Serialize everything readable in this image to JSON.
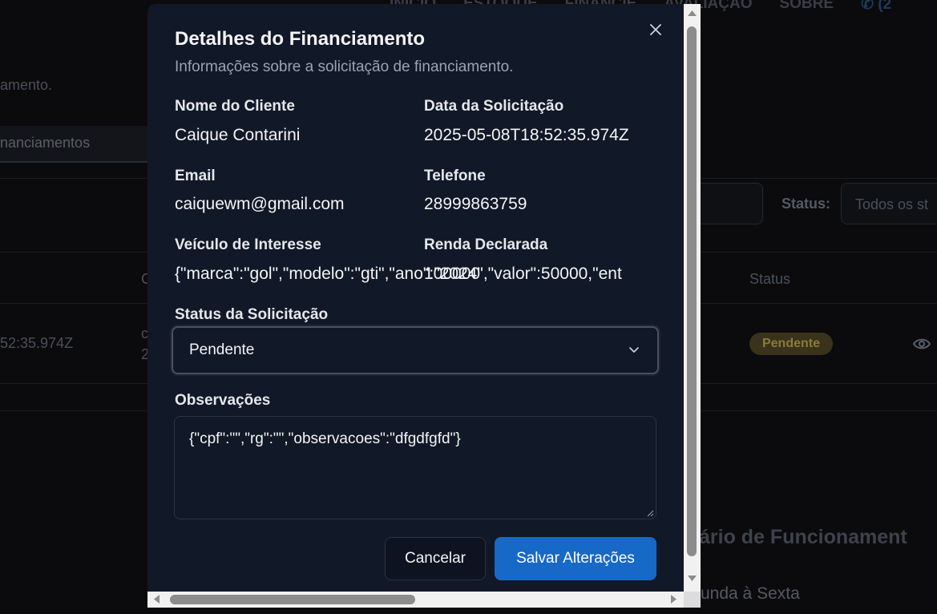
{
  "background": {
    "nav": [
      "INÍCIO",
      "ESTOQUE",
      "FINANCIE",
      "AVALIAÇÃO",
      "SOBRE"
    ],
    "phone_text": "(2",
    "subtitle_fragment": "amento.",
    "tab_label": "nanciamentos",
    "status_label": "Status:",
    "status_select_value": "Todos os st",
    "table_header_status": "Status",
    "table_header_fragment": "C",
    "row_date_fragment": "52:35.974Z",
    "row_cell_fragment_1": "c",
    "row_cell_fragment_2": "2",
    "row_badge": "Pendente",
    "heading_fragment": "ário de Funcionament",
    "schedule_fragment": "unda à Sexta"
  },
  "modal": {
    "title": "Detalhes do Financiamento",
    "subtitle": "Informações sobre a solicitação de financiamento.",
    "fields": {
      "client_name_label": "Nome do Cliente",
      "client_name_value": "Caique Contarini",
      "request_date_label": "Data da Solicitação",
      "request_date_value": "2025-05-08T18:52:35.974Z",
      "email_label": "Email",
      "email_value": "caiquewm@gmail.com",
      "phone_label": "Telefone",
      "phone_value": "28999863759",
      "vehicle_label": "Veículo de Interesse",
      "vehicle_value": "{\"marca\":\"gol\",\"modelo\":\"gti\",\"ano\":\"2024\",\"valor\":50000,\"ent",
      "income_label": "Renda Declarada",
      "income_value": "100000"
    },
    "status_label": "Status da Solicitação",
    "status_value": "Pendente",
    "notes_label": "Observações",
    "notes_value": "{\"cpf\":\"\",\"rg\":\"\",\"observacoes\":\"dfgdfgfd\"}",
    "cancel_label": "Cancelar",
    "save_label": "Salvar Alterações"
  },
  "colors": {
    "modal_bg": "#111827",
    "primary": "#1769c7",
    "badge_bg": "#3a321a"
  }
}
